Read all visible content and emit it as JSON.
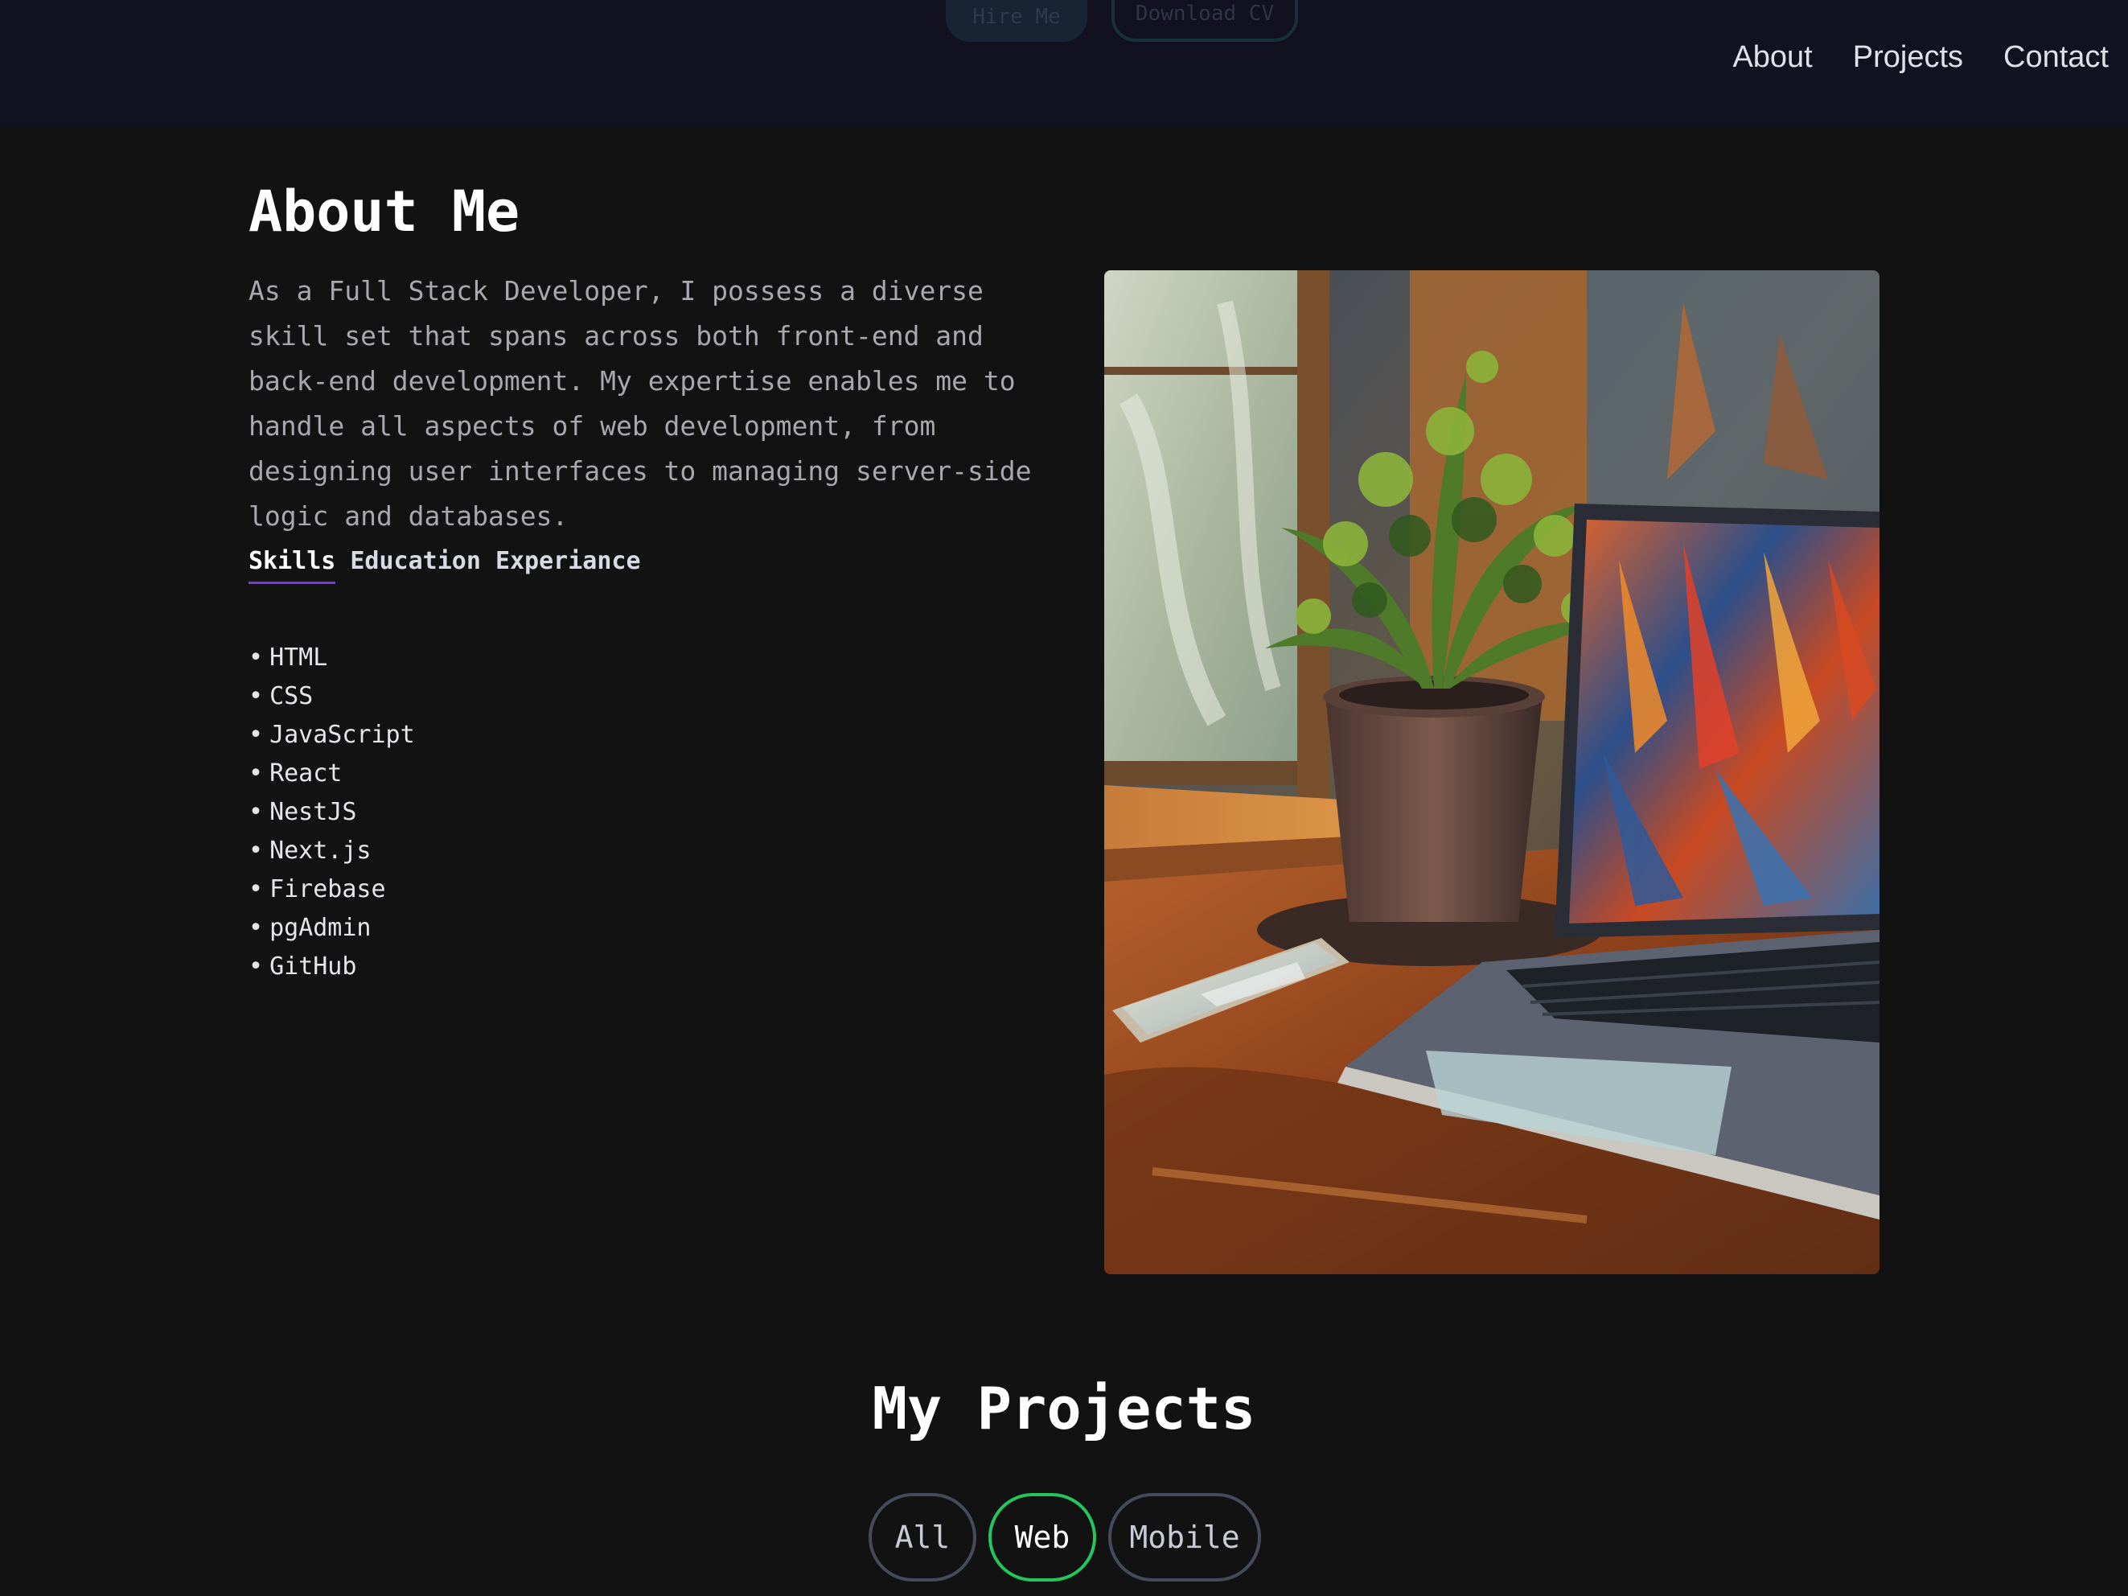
{
  "nav": {
    "links": [
      "About",
      "Projects",
      "Contact"
    ]
  },
  "hero_ghost": {
    "hire_label": "Hire Me",
    "cv_label": "Download CV"
  },
  "about": {
    "title": "About Me",
    "description": "As a Full Stack Developer, I possess a diverse skill set that spans across both front-end and back-end development. My expertise enables me to handle all aspects of web development, from designing user interfaces to managing server-side logic and databases.",
    "tabs": [
      "Skills",
      "Education",
      "Experiance"
    ],
    "active_tab": "Skills",
    "skills": [
      "HTML",
      "CSS",
      "JavaScript",
      "React",
      "NestJS",
      "Next.js",
      "Firebase",
      "pgAdmin",
      "GitHub"
    ]
  },
  "projects": {
    "title": "My Projects",
    "filters": [
      "All",
      "Web",
      "Mobile"
    ],
    "active_filter": "Web"
  },
  "colors": {
    "background": "#121212",
    "navbar": "#111120",
    "tab_underline": "#7b3ae0",
    "active_filter_border": "#22c55e"
  }
}
